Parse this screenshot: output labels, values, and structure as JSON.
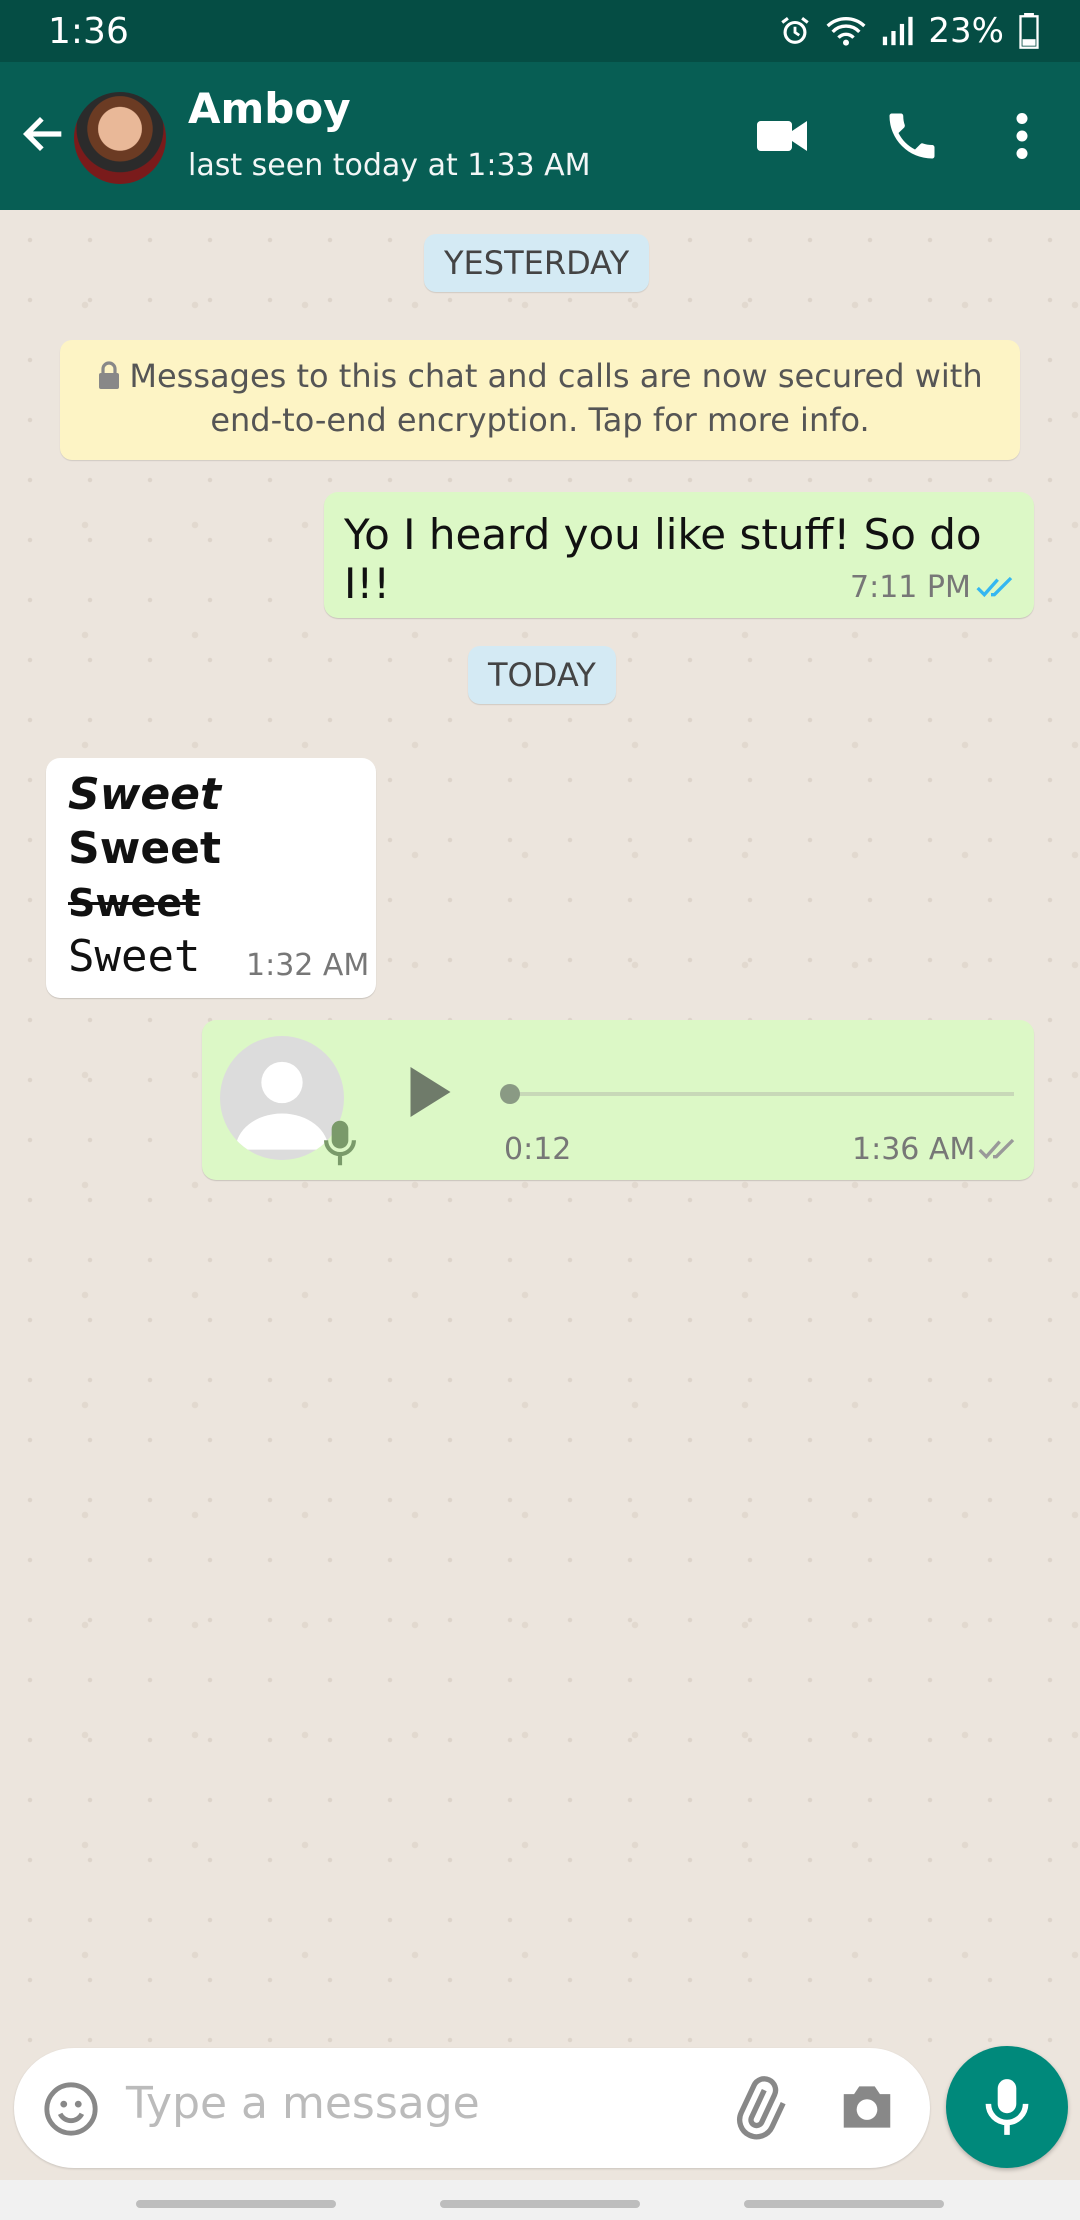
{
  "status": {
    "time": "1:36",
    "battery": "23%"
  },
  "header": {
    "name": "Amboy",
    "last_seen": "last seen today at 1:33 AM"
  },
  "messages": {
    "day1": "YESTERDAY",
    "encryption": "Messages to this chat and calls are now secured with end-to-end encryption. Tap for more info.",
    "m1_text": "Yo I heard you like stuff! So do I!!",
    "m1_time": "7:11 PM",
    "day2": "TODAY",
    "m2_lines": [
      "Sweet",
      "Sweet",
      "Sweet",
      "Sweet"
    ],
    "m2_time": "1:32 AM",
    "voice_duration": "0:12",
    "voice_time": "1:36 AM",
    "voice_progress": 0
  },
  "input": {
    "placeholder": "Type a message"
  },
  "colors": {
    "header": "#075e54",
    "statusbar": "#054d44",
    "outgoing": "#dcf8c6",
    "accent": "#00897b",
    "read_tick": "#34b7f1"
  }
}
